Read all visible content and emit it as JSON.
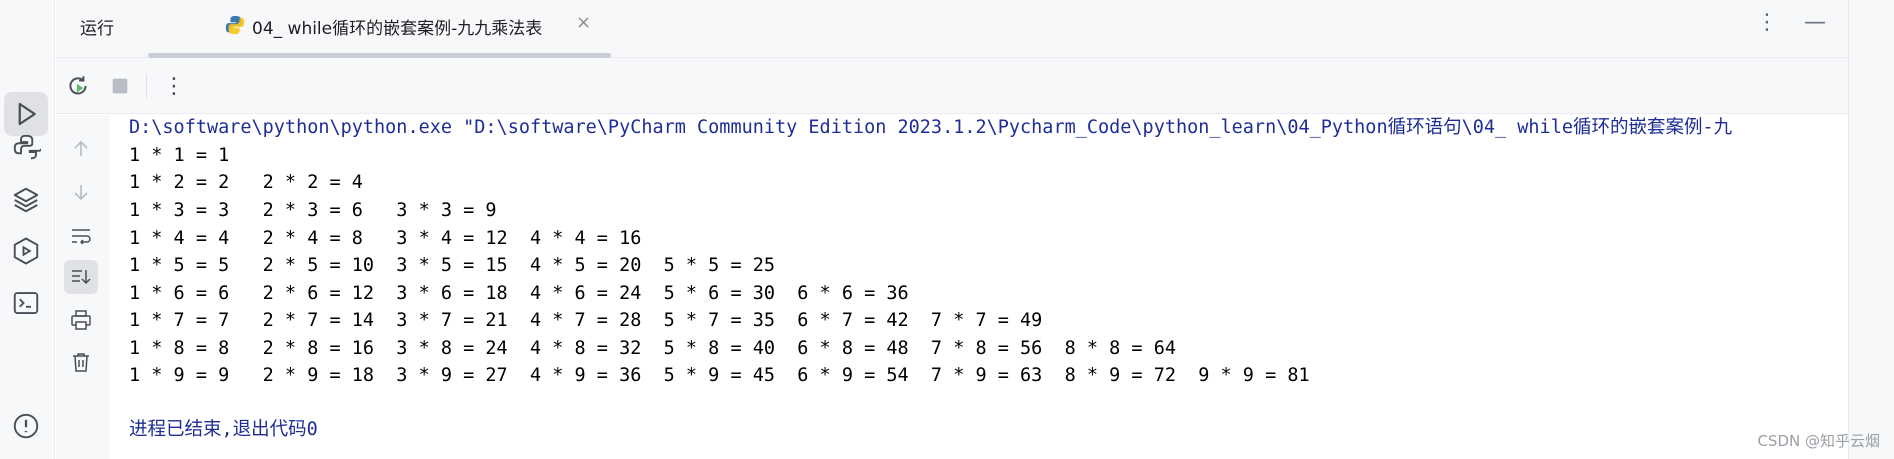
{
  "window": {
    "tool_window_title": "运行",
    "tab_label": "04_ while循环的嵌套案例-九九乘法表",
    "tab_close": "×",
    "more_menu": "⋮",
    "minimize": "—"
  },
  "toolbar": {
    "more_menu": "⋮"
  },
  "console": {
    "command": "D:\\software\\python\\python.exe \"D:\\software\\PyCharm Community Edition 2023.1.2\\Pycharm_Code\\python_learn\\04_Python循环语句\\04_ while循环的嵌套案例-九",
    "output_lines": [
      "1 * 1 = 1",
      "1 * 2 = 2   2 * 2 = 4",
      "1 * 3 = 3   2 * 3 = 6   3 * 3 = 9",
      "1 * 4 = 4   2 * 4 = 8   3 * 4 = 12  4 * 4 = 16",
      "1 * 5 = 5   2 * 5 = 10  3 * 5 = 15  4 * 5 = 20  5 * 5 = 25",
      "1 * 6 = 6   2 * 6 = 12  3 * 6 = 18  4 * 6 = 24  5 * 6 = 30  6 * 6 = 36",
      "1 * 7 = 7   2 * 7 = 14  3 * 7 = 21  4 * 7 = 28  5 * 7 = 35  6 * 7 = 42  7 * 7 = 49",
      "1 * 8 = 8   2 * 8 = 16  3 * 8 = 24  4 * 8 = 32  5 * 8 = 40  6 * 8 = 48  7 * 8 = 56  8 * 8 = 64",
      "1 * 9 = 9   2 * 9 = 18  3 * 9 = 27  4 * 9 = 36  5 * 9 = 45  6 * 9 = 54  7 * 9 = 63  8 * 9 = 72  9 * 9 = 81"
    ],
    "exit_message": "进程已结束,退出代码0"
  },
  "watermark": "CSDN @知乎云烟",
  "colors": {
    "command_text": "#1f2e96",
    "output_text": "#000000",
    "panel_bg": "#f7f8fa",
    "run_icon_green": "#5fb865"
  },
  "icons": {
    "left_strip": [
      "run-icon",
      "python-packages-icon",
      "layers-icon",
      "services-icon",
      "terminal-icon",
      "problems-icon"
    ],
    "toolbar": [
      "rerun-icon",
      "stop-icon",
      "more-icon"
    ],
    "gutter": [
      "scroll-up-icon",
      "scroll-down-icon",
      "soft-wrap-icon",
      "scroll-to-end-icon",
      "print-icon",
      "clear-icon"
    ]
  }
}
